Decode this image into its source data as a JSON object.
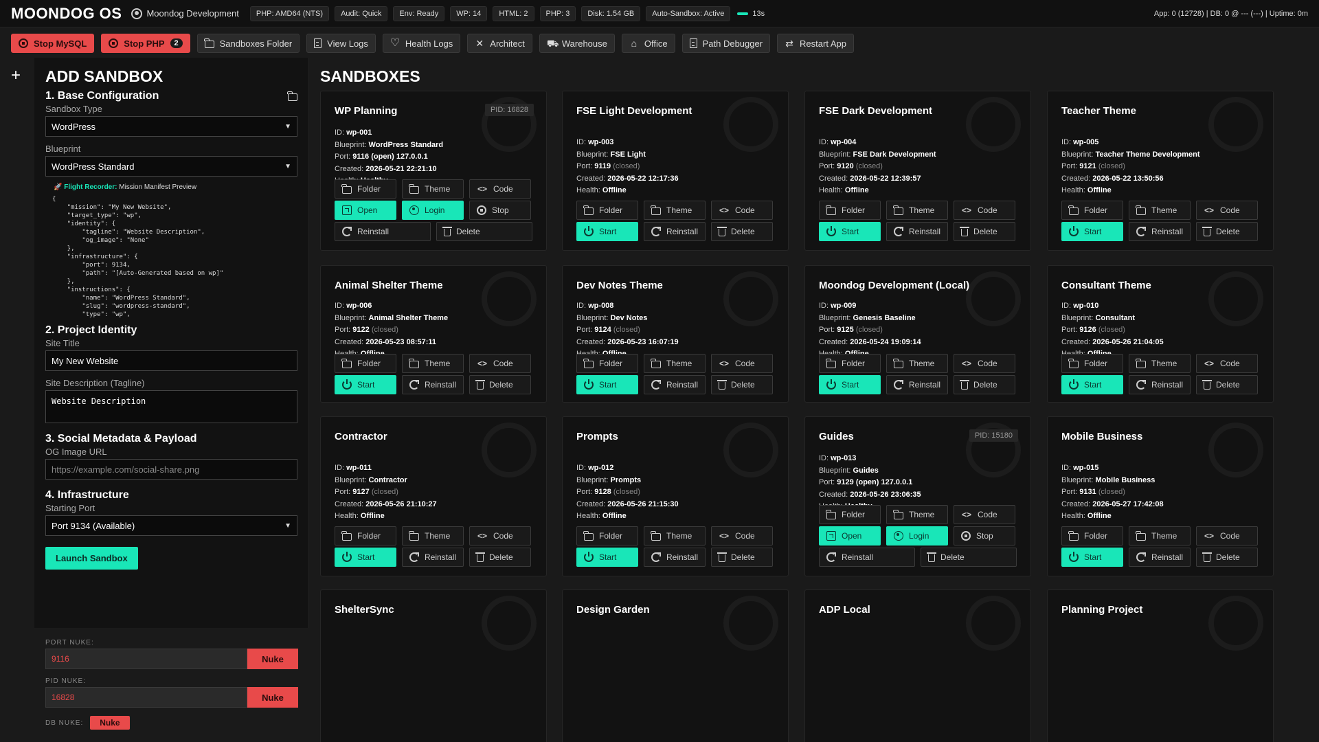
{
  "app": {
    "brand": "MOONDOG OS",
    "user": "Moondog Development",
    "status_chips": [
      "PHP: AMD64 (NTS)",
      "Audit: Quick",
      "Env: Ready",
      "WP: 14",
      "HTML: 2",
      "PHP: 3",
      "Disk: 1.54 GB",
      "Auto-Sandbox: Active"
    ],
    "timer": "13s",
    "right_status": "App: 0 (12728) | DB: 0 @ --- (---) | Uptime: 0m",
    "accent_color": "#19e6b8",
    "danger_color": "#e84a4a"
  },
  "toolbar": {
    "stop_mysql": "Stop MySQL",
    "stop_php": "Stop PHP",
    "stop_php_badge": "2",
    "sandboxes_folder": "Sandboxes Folder",
    "view_logs": "View Logs",
    "health_logs": "Health Logs",
    "architect": "Architect",
    "warehouse": "Warehouse",
    "office": "Office",
    "path_debugger": "Path Debugger",
    "restart_app": "Restart App"
  },
  "add": {
    "title": "ADD SANDBOX",
    "s1": "1. Base Configuration",
    "type_label": "Sandbox Type",
    "type_value": "WordPress",
    "blueprint_label": "Blueprint",
    "blueprint_value": "WordPress Standard",
    "recorder_label": "Flight Recorder:",
    "recorder_text": "Mission Manifest Preview",
    "manifest": "{\n    \"mission\": \"My New Website\",\n    \"target_type\": \"wp\",\n    \"identity\": {\n        \"tagline\": \"Website Description\",\n        \"og_image\": \"None\"\n    },\n    \"infrastructure\": {\n        \"port\": 9134,\n        \"path\": \"[Auto-Generated based on wp]\"\n    },\n    \"instructions\": {\n        \"name\": \"WordPress Standard\",\n        \"slug\": \"wordpress-standard\",\n        \"type\": \"wp\",",
    "s2": "2. Project Identity",
    "site_title_label": "Site Title",
    "site_title_value": "My New Website",
    "desc_label": "Site Description (Tagline)",
    "desc_value": "Website Description",
    "s3": "3. Social Metadata & Payload",
    "og_label": "OG Image URL",
    "og_placeholder": "https://example.com/social-share.png",
    "s4": "4. Infrastructure",
    "port_label": "Starting Port",
    "port_value": "Port 9134 (Available)",
    "launch": "Launch Sandbox",
    "port_nuke_label": "PORT NUKE:",
    "port_nuke_value": "9116",
    "pid_nuke_label": "PID NUKE:",
    "pid_nuke_value": "16828",
    "db_nuke_label": "DB NUKE:",
    "nuke": "Nuke"
  },
  "sandboxes": {
    "title": "SANDBOXES",
    "labels": {
      "id": "ID:",
      "blueprint": "Blueprint:",
      "port": "Port:",
      "created": "Created:",
      "health": "Health:"
    },
    "buttons": {
      "folder": "Folder",
      "theme": "Theme",
      "code": "Code",
      "open": "Open",
      "login": "Login",
      "stop": "Stop",
      "start": "Start",
      "reinstall": "Reinstall",
      "delete": "Delete"
    },
    "cards": [
      {
        "name": "WP Planning",
        "pid": "PID: 16828",
        "id": "wp-001",
        "blueprint": "WordPress Standard",
        "port": "9116 (open) 127.0.0.1",
        "port_status": "",
        "created": "2026-05-21 22:21:10",
        "health": "Healthy"
      },
      {
        "name": "FSE Light Development",
        "pid": "",
        "id": "wp-003",
        "blueprint": "FSE Light",
        "port": "9119",
        "port_status": "(closed)",
        "created": "2026-05-22 12:17:36",
        "health": "Offline"
      },
      {
        "name": "FSE Dark Development",
        "pid": "",
        "id": "wp-004",
        "blueprint": "FSE Dark Development",
        "port": "9120",
        "port_status": "(closed)",
        "created": "2026-05-22 12:39:57",
        "health": "Offline"
      },
      {
        "name": "Teacher Theme",
        "pid": "",
        "id": "wp-005",
        "blueprint": "Teacher Theme Development",
        "port": "9121",
        "port_status": "(closed)",
        "created": "2026-05-22 13:50:56",
        "health": "Offline"
      },
      {
        "name": "Animal Shelter Theme",
        "pid": "",
        "id": "wp-006",
        "blueprint": "Animal Shelter Theme",
        "port": "9122",
        "port_status": "(closed)",
        "created": "2026-05-23 08:57:11",
        "health": "Offline"
      },
      {
        "name": "Dev Notes Theme",
        "pid": "",
        "id": "wp-008",
        "blueprint": "Dev Notes",
        "port": "9124",
        "port_status": "(closed)",
        "created": "2026-05-23 16:07:19",
        "health": "Offline"
      },
      {
        "name": "Moondog Development (Local)",
        "pid": "",
        "id": "wp-009",
        "blueprint": "Genesis Baseline",
        "port": "9125",
        "port_status": "(closed)",
        "created": "2026-05-24 19:09:14",
        "health": "Offline"
      },
      {
        "name": "Consultant Theme",
        "pid": "",
        "id": "wp-010",
        "blueprint": "Consultant",
        "port": "9126",
        "port_status": "(closed)",
        "created": "2026-05-26 21:04:05",
        "health": "Offline"
      },
      {
        "name": "Contractor",
        "pid": "",
        "id": "wp-011",
        "blueprint": "Contractor",
        "port": "9127",
        "port_status": "(closed)",
        "created": "2026-05-26 21:10:27",
        "health": "Offline"
      },
      {
        "name": "Prompts",
        "pid": "",
        "id": "wp-012",
        "blueprint": "Prompts",
        "port": "9128",
        "port_status": "(closed)",
        "created": "2026-05-26 21:15:30",
        "health": "Offline"
      },
      {
        "name": "Guides",
        "pid": "PID: 15180",
        "id": "wp-013",
        "blueprint": "Guides",
        "port": "9129 (open) 127.0.0.1",
        "port_status": "",
        "created": "2026-05-26 23:06:35",
        "health": "Healthy"
      },
      {
        "name": "Mobile Business",
        "pid": "",
        "id": "wp-015",
        "blueprint": "Mobile Business",
        "port": "9131",
        "port_status": "(closed)",
        "created": "2026-05-27 17:42:08",
        "health": "Offline"
      },
      {
        "name": "ShelterSync"
      },
      {
        "name": "Design Garden"
      },
      {
        "name": "ADP Local"
      },
      {
        "name": "Planning Project"
      }
    ]
  }
}
